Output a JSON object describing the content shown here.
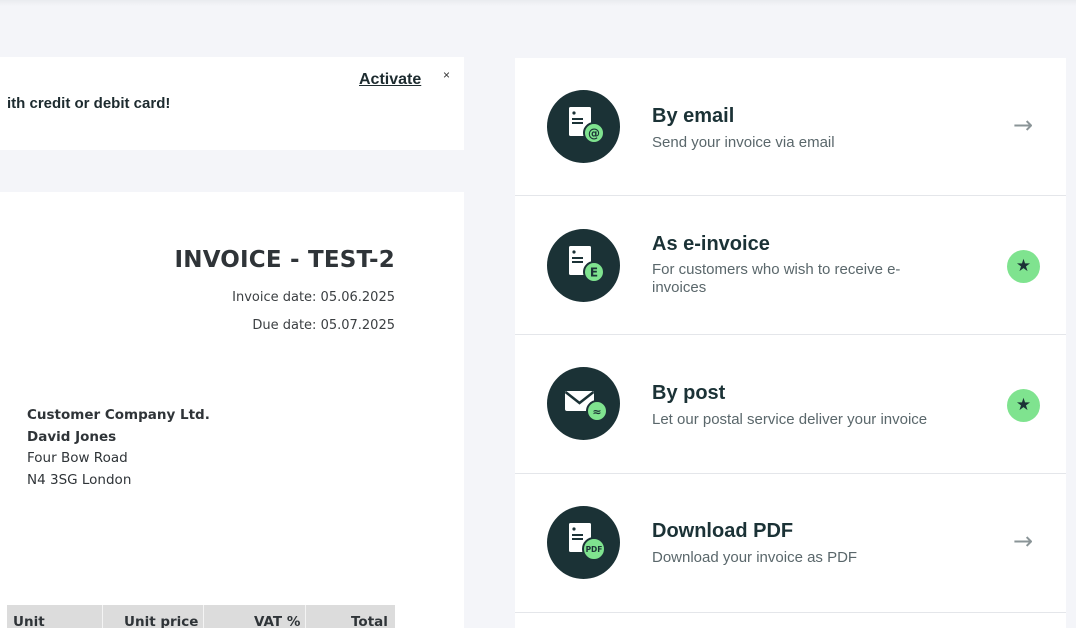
{
  "banner": {
    "text": "ith credit or debit card!",
    "activate_label": "Activate",
    "close_label": "×"
  },
  "invoice": {
    "title": "INVOICE - TEST-2",
    "invoice_date": "Invoice date: 05.06.2025",
    "due_date": "Due date: 05.07.2025",
    "customer": {
      "company": "Customer Company Ltd.",
      "contact": "David Jones",
      "street": "Four Bow Road",
      "city": "N4 3SG London"
    },
    "table_headers": [
      "Unit",
      "Unit price",
      "VAT %",
      "Total"
    ]
  },
  "options": [
    {
      "title": "By email",
      "description": "Send your invoice via email",
      "icon": "email-document-icon",
      "badge_text": "@",
      "action": "arrow"
    },
    {
      "title": "As e-invoice",
      "description": "For customers who wish to receive e-invoices",
      "icon": "e-invoice-document-icon",
      "badge_text": "E",
      "action": "star"
    },
    {
      "title": "By post",
      "description": "Let our postal service deliver your invoice",
      "icon": "envelope-icon",
      "badge_text": "≈",
      "action": "star"
    },
    {
      "title": "Download PDF",
      "description": "Download your invoice as PDF",
      "icon": "pdf-document-icon",
      "badge_text": "PDF",
      "action": "arrow"
    }
  ],
  "glyphs": {
    "arrow": "→",
    "star": "★"
  },
  "colors": {
    "icon_bg": "#1b3236",
    "accent": "#7fe38f"
  }
}
